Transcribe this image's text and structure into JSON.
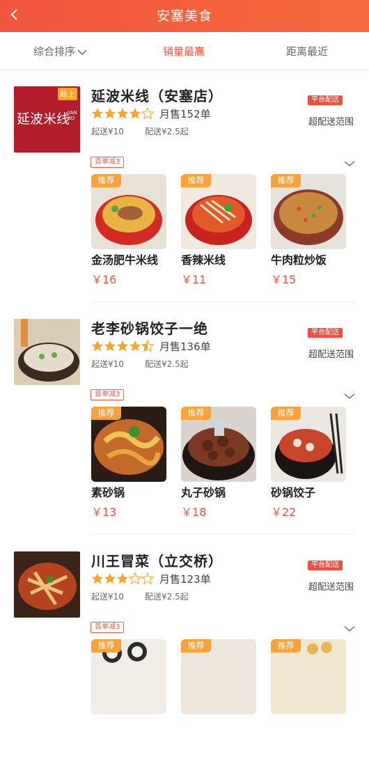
{
  "header": {
    "title": "安塞美食"
  },
  "sort_tabs": [
    {
      "label": "综合排序"
    },
    {
      "label": "销量最高"
    },
    {
      "label": "距离最近"
    }
  ],
  "colors": {
    "brand": "#f2553e",
    "star": "#f6a623",
    "tag_orange": "#f7a23a"
  },
  "stores": [
    {
      "name": "延波米线（安塞店）",
      "thumb_text": "延波米线",
      "thumb_small": "YAN BO",
      "thumb_new": "新上",
      "rating": 4,
      "monthly": "月售152单",
      "min_order": "起送¥10",
      "delivery": "配送¥2.5起",
      "platform_badge": "平台配送",
      "range": "超配送范围",
      "promo": "首单减3",
      "dishes": [
        {
          "tag": "推荐",
          "name": "金汤肥牛米线",
          "price": "￥16"
        },
        {
          "tag": "推荐",
          "name": "香辣米线",
          "price": "￥11"
        },
        {
          "tag": "推荐",
          "name": "牛肉粒炒饭",
          "price": "￥15"
        }
      ]
    },
    {
      "name": "老李砂锅饺子一绝",
      "rating": 4.5,
      "monthly": "月售136单",
      "min_order": "起送¥10",
      "delivery": "配送¥2.5起",
      "platform_badge": "平台配送",
      "range": "超配送范围",
      "promo": "首单减3",
      "dishes": [
        {
          "tag": "推荐",
          "name": "素砂锅",
          "price": "￥13"
        },
        {
          "tag": "推荐",
          "name": "丸子砂锅",
          "price": "￥18"
        },
        {
          "tag": "推荐",
          "name": "砂锅饺子",
          "price": "￥22"
        }
      ]
    },
    {
      "name": "川王冒菜（立交桥）",
      "rating": 3,
      "monthly": "月售123单",
      "min_order": "起送¥10",
      "delivery": "配送¥2.5起",
      "platform_badge": "平台配送",
      "range": "超配送范围",
      "promo": "首单减3",
      "dishes": [
        {
          "tag": "推荐"
        },
        {
          "tag": "推荐"
        },
        {
          "tag": "推荐"
        }
      ]
    }
  ]
}
